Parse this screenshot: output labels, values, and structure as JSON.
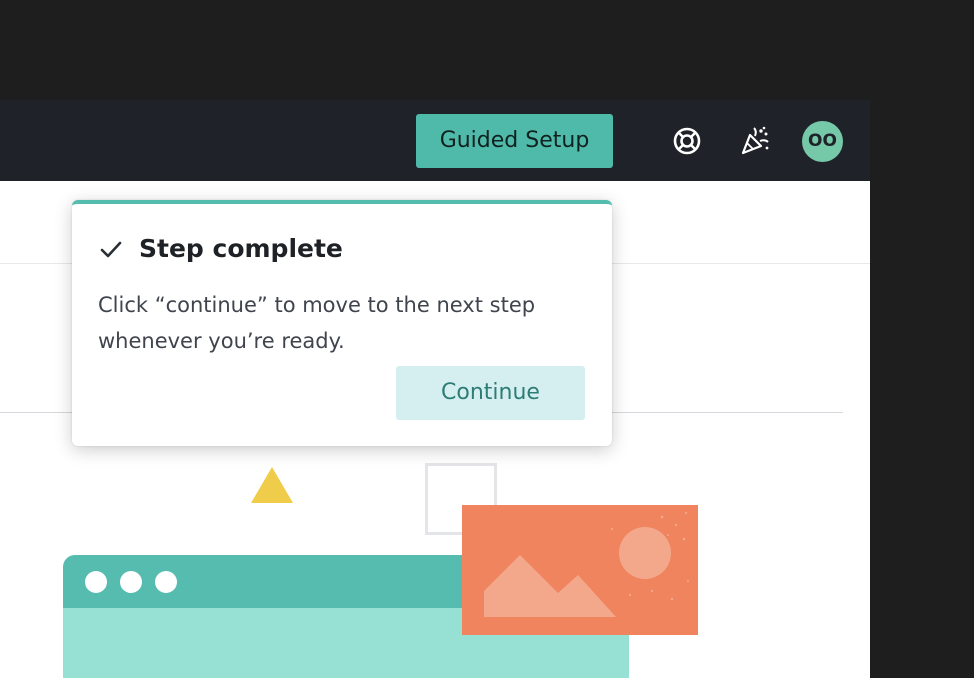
{
  "topbar": {
    "guided_setup_label": "Guided Setup",
    "help_icon": "lifebuoy-icon",
    "whats_new_icon": "party-popper-icon",
    "avatar_initials": "OO"
  },
  "tooltip": {
    "title": "Step complete",
    "body": "Click “continue” to move to the next step whenever you’re ready.",
    "continue_label": "Continue",
    "check_icon": "checkmark-icon"
  },
  "colors": {
    "background": "#1e1e1e",
    "topbar": "#1f2228",
    "accent_teal": "#4fb9aa",
    "avatar": "#76c9a8",
    "continue_bg": "#d5eff0",
    "continue_text": "#2d7c76",
    "illustration_orange": "#ef845e",
    "illustration_yellow": "#f0cc4b",
    "illustration_mint": "#97e1d4"
  }
}
